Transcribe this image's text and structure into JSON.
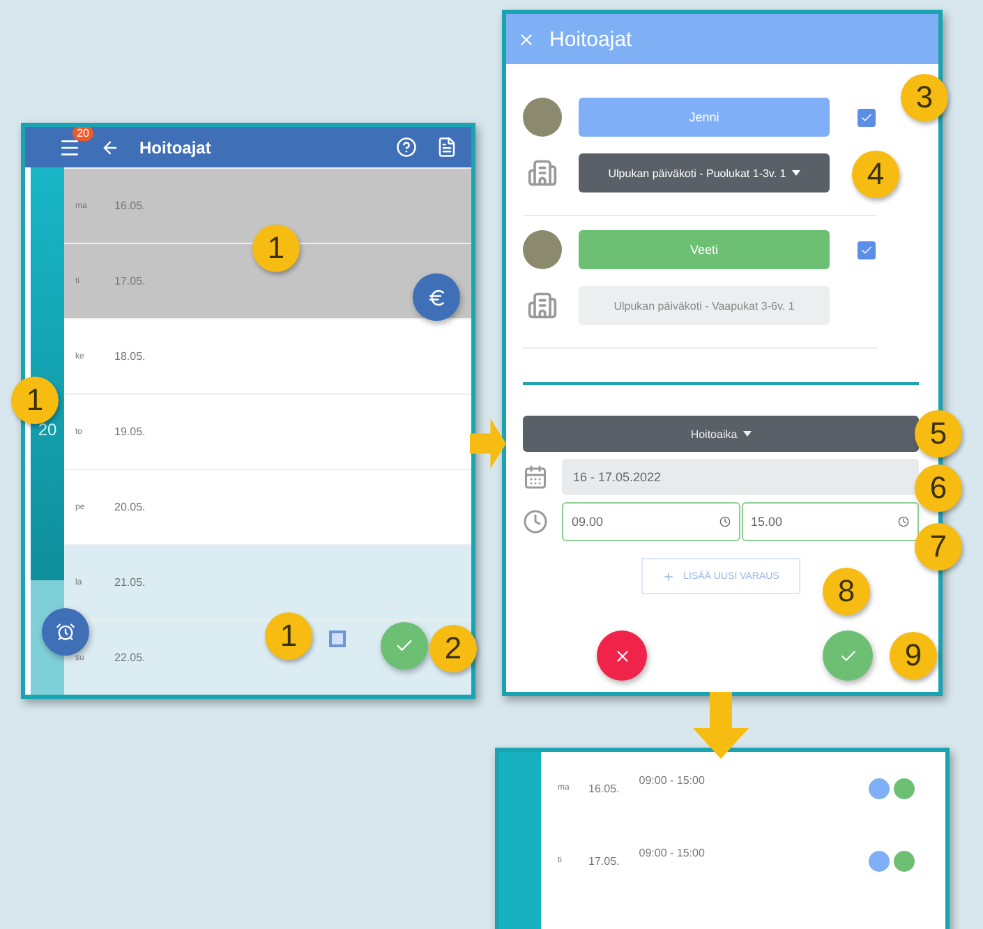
{
  "calendar_panel": {
    "badge": "20",
    "title": "Hoitoajat",
    "week_number": "20",
    "days": [
      {
        "day": "ma",
        "date": "16.05.",
        "selected": true,
        "weekend": false
      },
      {
        "day": "ti",
        "date": "17.05.",
        "selected": true,
        "weekend": false
      },
      {
        "day": "ke",
        "date": "18.05.",
        "selected": false,
        "weekend": false
      },
      {
        "day": "to",
        "date": "19.05.",
        "selected": false,
        "weekend": false
      },
      {
        "day": "pe",
        "date": "20.05.",
        "selected": false,
        "weekend": false
      },
      {
        "day": "la",
        "date": "21.05.",
        "selected": false,
        "weekend": true
      },
      {
        "day": "su",
        "date": "22.05.",
        "selected": false,
        "weekend": true
      }
    ]
  },
  "dialog": {
    "title": "Hoitoajat",
    "children": [
      {
        "name": "Jenni",
        "color": "#7fb0f7",
        "checked": true,
        "group": "Ulpukan päiväkoti - Puolukat 1-3v. 1",
        "group_disabled": false
      },
      {
        "name": "Veeti",
        "color": "#6cbf73",
        "checked": true,
        "group": "Ulpukan päiväkoti - Vaapukat 3-6v. 1",
        "group_disabled": true
      }
    ],
    "type_select": "Hoitoaika",
    "date_range": "16 - 17.05.2022",
    "start_time": "09.00",
    "end_time": "15.00",
    "add_button": "LISÄÄ UUSI VARAUS"
  },
  "result_panel": {
    "rows": [
      {
        "day": "ma",
        "date": "16.05.",
        "time": "09:00 - 15:00",
        "dots": [
          {
            "color": "#7fb0f7"
          },
          {
            "color": "#6cbf73"
          }
        ]
      },
      {
        "day": "ti",
        "date": "17.05.",
        "time": "09:00 - 15:00",
        "dots": [
          {
            "color": "#7fb0f7"
          },
          {
            "color": "#6cbf73"
          }
        ]
      }
    ]
  },
  "callouts": [
    "1",
    "1",
    "1",
    "2",
    "3",
    "4",
    "5",
    "6",
    "7",
    "8",
    "9"
  ]
}
